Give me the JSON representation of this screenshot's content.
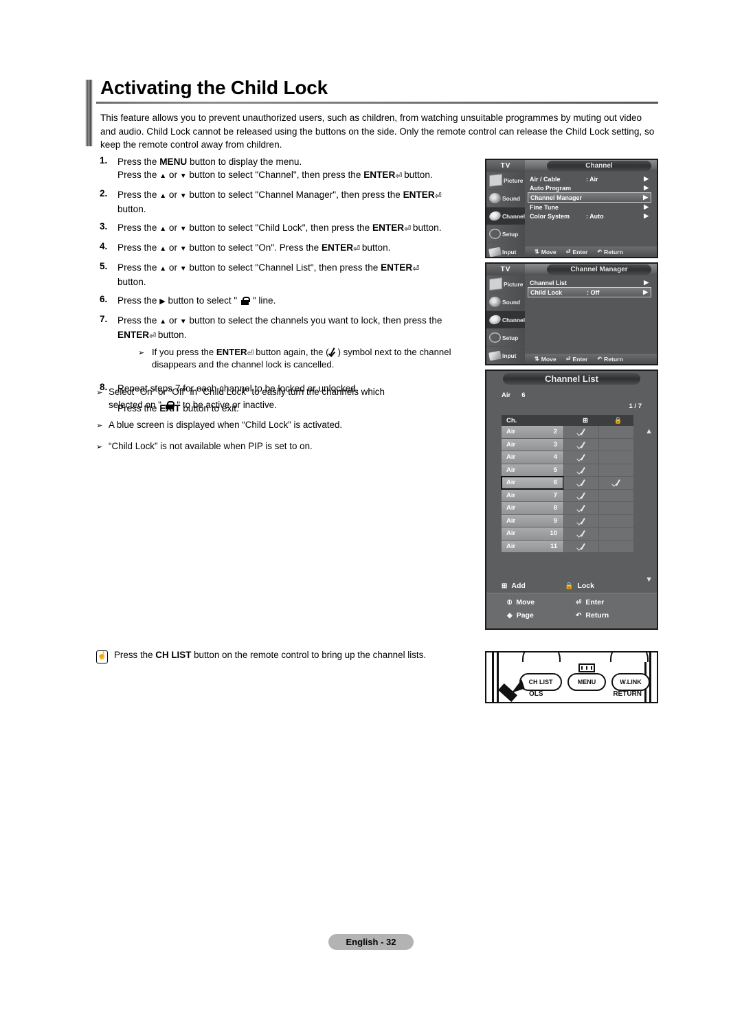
{
  "page": {
    "title": "Activating the Child Lock",
    "intro": "This feature allows you to prevent unauthorized users, such as children, from watching unsuitable programmes by muting out video and audio. Child Lock cannot be released using the buttons on the side. Only the remote control can release the Child Lock setting, so keep the remote control away from children.",
    "footer_badge": "English - 32"
  },
  "steps": [
    {
      "num": "1.",
      "line1_a": "Press the ",
      "line1_b": "MENU",
      "line1_c": " button to display the menu.",
      "line2_a": "Press the ",
      "line2_b": " or ",
      "line2_c": " button to  select \"Channel\", then press the ",
      "line2_d": "ENTER",
      "line2_e": " button."
    },
    {
      "num": "2.",
      "line1_a": "Press the ",
      "line1_b": " or ",
      "line1_c": " button to select \"Channel Manager\", then press the ",
      "line1_d": "ENTER",
      "line2": "button."
    },
    {
      "num": "3.",
      "line1_a": "Press the ",
      "line1_b": " or ",
      "line1_c": " button to select \"Child Lock\", then press the ",
      "line1_d": "ENTER",
      "line1_e": " button."
    },
    {
      "num": "4.",
      "line1_a": "Press the ",
      "line1_b": " or ",
      "line1_c": " button to select \"On\". Press the ",
      "line1_d": "ENTER",
      "line1_e": " button."
    },
    {
      "num": "5.",
      "line1_a": "Press the ",
      "line1_b": " or ",
      "line1_c": " button to select \"Channel List\", then press the ",
      "line1_d": "ENTER",
      "line2": "button."
    },
    {
      "num": "6.",
      "line1_a": "Press the ",
      "line1_b": " button to select \" ",
      "line1_c": " \" line."
    },
    {
      "num": "7.",
      "line1_a": "Press the ",
      "line1_b": " or ",
      "line1_c": " button to select the channels you want to lock, then press the ",
      "line2_a": "ENTER",
      "line2_b": " button.",
      "subnote_a": "If you press the ",
      "subnote_b": "ENTER",
      "subnote_c": " button again, the (",
      "subnote_d": ") symbol next to the channel",
      "subnote_e": "disappears and the channel lock is cancelled."
    },
    {
      "num": "8.",
      "line1": "Repeat steps 7 for each channel to be locked or unlocked.",
      "line2_a": "Press the ",
      "line2_b": "EXIT",
      "line2_c": " button to exit."
    }
  ],
  "notes": [
    {
      "line1": "Select \"On\" or \"Off\" in \"Child Lock\" to easily turn the channels which",
      "line2_a": "selected on \" ",
      "line2_b": " \" to be active or inactive."
    },
    {
      "line1": "A blue screen is displayed when “Child Lock” is activated."
    },
    {
      "line1": "“Child Lock” is not available when PIP is set to on."
    }
  ],
  "remote_note": {
    "text_a": "Press the ",
    "text_b": "CH LIST",
    "text_c": " button on the remote control to bring up the channel lists."
  },
  "sidebar": {
    "items": [
      {
        "label": "Picture",
        "icon": "picture-icon"
      },
      {
        "label": "Sound",
        "icon": "sound-icon"
      },
      {
        "label": "Channel",
        "icon": "channel-icon"
      },
      {
        "label": "Setup",
        "icon": "setup-icon"
      },
      {
        "label": "Input",
        "icon": "input-icon"
      }
    ]
  },
  "menu_bottom_bar": {
    "move": "Move",
    "enter": "Enter",
    "return": "Return"
  },
  "panel_channel": {
    "tv_label": "TV",
    "title": "Channel",
    "rows": [
      {
        "label": "Air / Cable",
        "value": ": Air",
        "selected": false
      },
      {
        "label": "Auto Program",
        "value": "",
        "selected": false
      },
      {
        "label": "Channel Manager",
        "value": "",
        "selected": true
      },
      {
        "label": "Fine Tune",
        "value": "",
        "selected": false
      },
      {
        "label": "Color System",
        "value": ": Auto",
        "selected": false
      }
    ]
  },
  "panel_manager": {
    "tv_label": "TV",
    "title": "Channel Manager",
    "rows": [
      {
        "label": "Channel List",
        "value": "",
        "selected": false
      },
      {
        "label": "Child Lock",
        "value": ": Off",
        "selected": true
      }
    ]
  },
  "panel_channel_list": {
    "title": "Channel List",
    "current_source": "Air",
    "current_channel": "6",
    "page_indicator": "1 / 7",
    "columns": {
      "ch": "Ch.",
      "add": "add-icon",
      "lock": "lock-icon"
    },
    "rows": [
      {
        "source": "Air",
        "number": "2",
        "added": true,
        "locked": false,
        "selected": false
      },
      {
        "source": "Air",
        "number": "3",
        "added": true,
        "locked": false,
        "selected": false
      },
      {
        "source": "Air",
        "number": "4",
        "added": true,
        "locked": false,
        "selected": false
      },
      {
        "source": "Air",
        "number": "5",
        "added": true,
        "locked": false,
        "selected": false
      },
      {
        "source": "Air",
        "number": "6",
        "added": true,
        "locked": true,
        "selected": true
      },
      {
        "source": "Air",
        "number": "7",
        "added": true,
        "locked": false,
        "selected": false
      },
      {
        "source": "Air",
        "number": "8",
        "added": true,
        "locked": false,
        "selected": false
      },
      {
        "source": "Air",
        "number": "9",
        "added": true,
        "locked": false,
        "selected": false
      },
      {
        "source": "Air",
        "number": "10",
        "added": true,
        "locked": false,
        "selected": false
      },
      {
        "source": "Air",
        "number": "11",
        "added": true,
        "locked": false,
        "selected": false
      }
    ],
    "actions": {
      "add": "Add",
      "lock": "Lock"
    },
    "footer": {
      "move": "Move",
      "enter": "Enter",
      "page": "Page",
      "return": "Return"
    }
  },
  "remote": {
    "buttons": [
      {
        "label": "CH LIST"
      },
      {
        "label": "MENU"
      },
      {
        "label": "W.LINK"
      }
    ],
    "tools_label": "OLS",
    "return_label": "RETURN"
  }
}
